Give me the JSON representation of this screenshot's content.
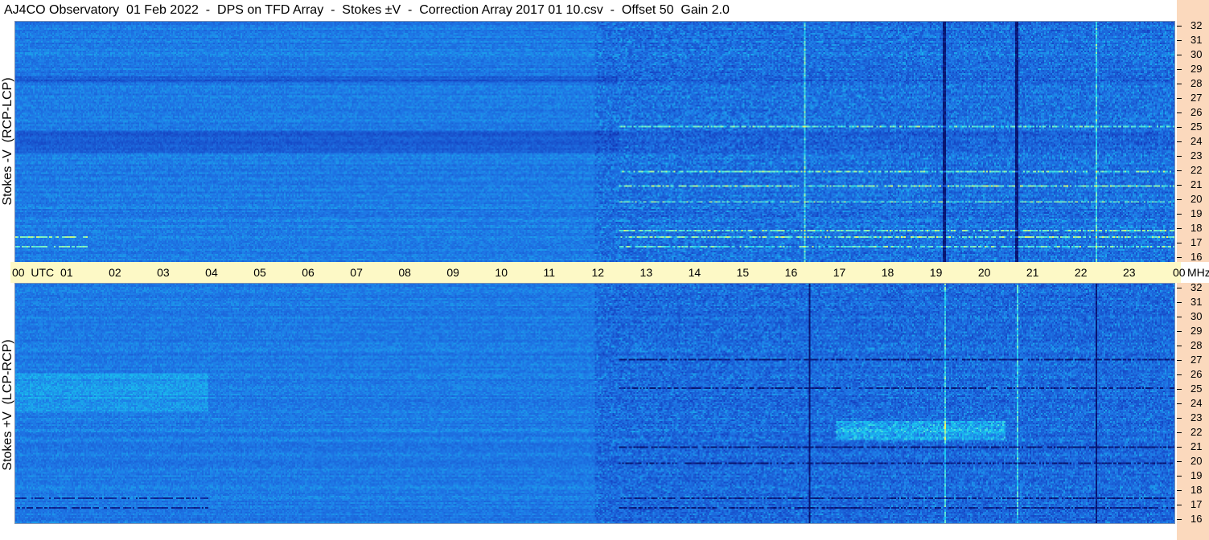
{
  "title": "AJ4CO Observatory  01 Feb 2022  -  DPS on TFD Array  -  Stokes ±V  -  Correction Array 2017 01 10.csv  -  Offset 50  Gain 2.0",
  "panels": [
    {
      "ylabel": "Stokes -V  (RCP-LCP)"
    },
    {
      "ylabel": "Stokes +V  (LCP-RCP)"
    }
  ],
  "colors": {
    "background_blue": "#1e78e6",
    "deep_blue": "#1438a8",
    "cyan": "#19d8f0",
    "yellow": "#f0f060",
    "time_axis_bg": "#fdf9c6",
    "freq_axis_bg": "#fbd9bd"
  },
  "chart_data": {
    "type": "heatmap",
    "description_kind": "dynamic spectrogram",
    "x_axis": {
      "unit": "UTC",
      "range": [
        0,
        24
      ],
      "tick_labels": [
        "00  UTC",
        "01",
        "02",
        "03",
        "04",
        "05",
        "06",
        "07",
        "08",
        "09",
        "10",
        "11",
        "12",
        "13",
        "14",
        "15",
        "16",
        "17",
        "18",
        "19",
        "20",
        "21",
        "22",
        "23",
        "00"
      ]
    },
    "y_axis": {
      "unit": "MHz",
      "range": [
        16,
        32
      ],
      "tick_labels": [
        "32",
        "31",
        "30",
        "29",
        "28",
        "27",
        "26",
        "25",
        "24",
        "23",
        "22",
        "21",
        "20",
        "19",
        "18",
        "17",
        "16"
      ]
    },
    "freq_unit_label": "MHz",
    "features": {
      "top": {
        "cyan_vertical_lines_utc": [
          16.35,
          22.4
        ],
        "dark_vertical_lines_utc": [
          19.25,
          20.75
        ],
        "dark_band_mhz": [
          [
            28.0,
            28.4
          ],
          [
            23.3,
            24.8
          ]
        ],
        "bright_horizontal_lines_mhz": [
          17.0,
          17.6,
          18.0,
          20.0,
          21.0,
          25.0,
          22.0
        ],
        "rfi_onset_utc": 12.0
      },
      "bottom": {
        "dark_vertical_lines_utc": [
          16.45,
          22.4
        ],
        "cyan_vertical_lines_utc": [
          19.25,
          20.75
        ],
        "dark_horizontal_lines_mhz": [
          17.0,
          17.6,
          20.0,
          21.0,
          25.0,
          27.0
        ],
        "bright_band_mhz": [
          21.5,
          22.8
        ],
        "bright_band_utc": [
          17.0,
          20.5
        ],
        "rfi_onset_utc": 12.0
      }
    }
  }
}
